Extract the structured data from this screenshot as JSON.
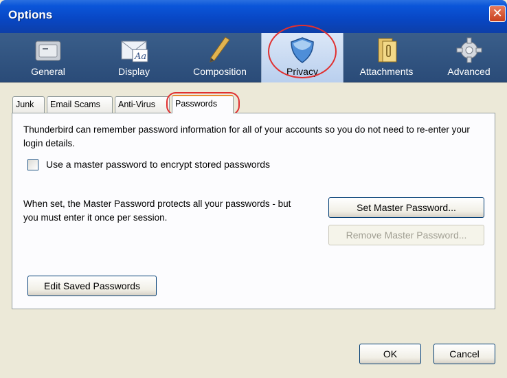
{
  "window": {
    "title": "Options",
    "close_glyph": "✕"
  },
  "toolbar": {
    "panes": [
      {
        "label": "General",
        "icon": "general-icon"
      },
      {
        "label": "Display",
        "icon": "display-icon"
      },
      {
        "label": "Composition",
        "icon": "composition-icon"
      },
      {
        "label": "Privacy",
        "icon": "privacy-shield-icon",
        "active": true
      },
      {
        "label": "Attachments",
        "icon": "attachments-icon"
      },
      {
        "label": "Advanced",
        "icon": "advanced-gear-icon"
      }
    ]
  },
  "tabs": [
    {
      "label": "Junk"
    },
    {
      "label": "Email Scams"
    },
    {
      "label": "Anti-Virus"
    },
    {
      "label": "Passwords",
      "active": true
    }
  ],
  "passwords": {
    "description": "Thunderbird can remember password information for all of your accounts so you do not need to re-enter your login details.",
    "master_checkbox_label": "Use a master password to encrypt stored passwords",
    "master_checkbox_checked": false,
    "master_text": "When set, the Master Password protects all your passwords - but you must enter it once per session.",
    "set_master_label": "Set Master Password...",
    "remove_master_label": "Remove Master Password...",
    "edit_saved_label": "Edit Saved Passwords"
  },
  "dialog_buttons": {
    "ok_label": "OK",
    "cancel_label": "Cancel"
  },
  "colors": {
    "titlebar": "#0a55d9",
    "highlight_ring": "#e03030",
    "active_tab_accent": "#e68b2c"
  }
}
